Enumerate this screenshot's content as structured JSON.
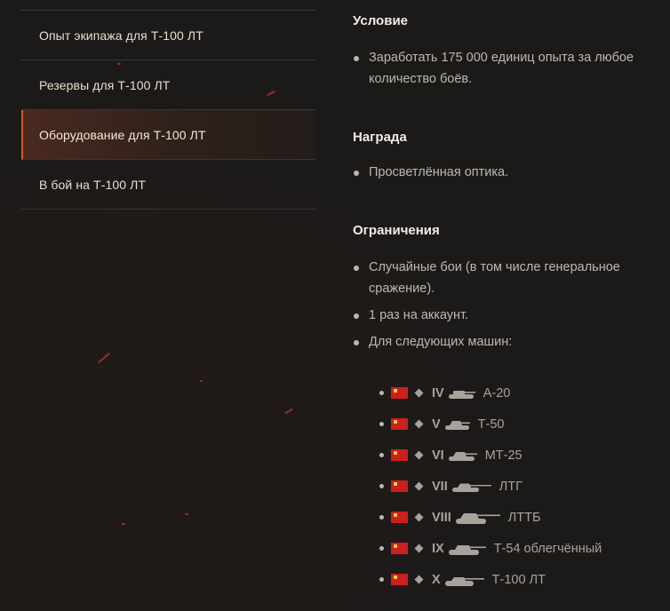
{
  "menu": {
    "items": [
      {
        "label": "Опыт экипажа для Т-100 ЛТ",
        "active": false
      },
      {
        "label": "Резервы для Т-100 ЛТ",
        "active": false
      },
      {
        "label": "Оборудование для Т-100 ЛТ",
        "active": true
      },
      {
        "label": "В бой на Т-100 ЛТ",
        "active": false
      }
    ]
  },
  "condition": {
    "title": "Условие",
    "items": [
      "Заработать 175 000 единиц опыта за любое количество боёв."
    ]
  },
  "reward": {
    "title": "Награда",
    "items": [
      "Просветлённая оптика."
    ]
  },
  "restrictions": {
    "title": "Ограничения",
    "items": [
      "Случайные бои (в том числе генеральное сражение).",
      "1 раз на аккаунт.",
      "Для следующих машин:"
    ]
  },
  "vehicles": [
    {
      "tier": "IV",
      "name": "А-20",
      "nation_icon": "ussr-flag-icon",
      "class_icon": "light-tank-diamond-icon"
    },
    {
      "tier": "V",
      "name": "Т-50",
      "nation_icon": "ussr-flag-icon",
      "class_icon": "light-tank-diamond-icon"
    },
    {
      "tier": "VI",
      "name": "МТ-25",
      "nation_icon": "ussr-flag-icon",
      "class_icon": "light-tank-diamond-icon"
    },
    {
      "tier": "VII",
      "name": "ЛТГ",
      "nation_icon": "ussr-flag-icon",
      "class_icon": "light-tank-diamond-icon"
    },
    {
      "tier": "VIII",
      "name": "ЛТТБ",
      "nation_icon": "ussr-flag-icon",
      "class_icon": "light-tank-diamond-icon"
    },
    {
      "tier": "IX",
      "name": "Т-54 облегчённый",
      "nation_icon": "ussr-flag-icon",
      "class_icon": "light-tank-diamond-icon"
    },
    {
      "tier": "X",
      "name": "Т-100 ЛТ",
      "nation_icon": "ussr-flag-icon",
      "class_icon": "light-tank-diamond-icon"
    }
  ],
  "colors": {
    "background": "#1b1a19",
    "active_accent": "#d05a2a",
    "flag_red": "#cc1f1f",
    "text_muted": "#a8a39a"
  }
}
